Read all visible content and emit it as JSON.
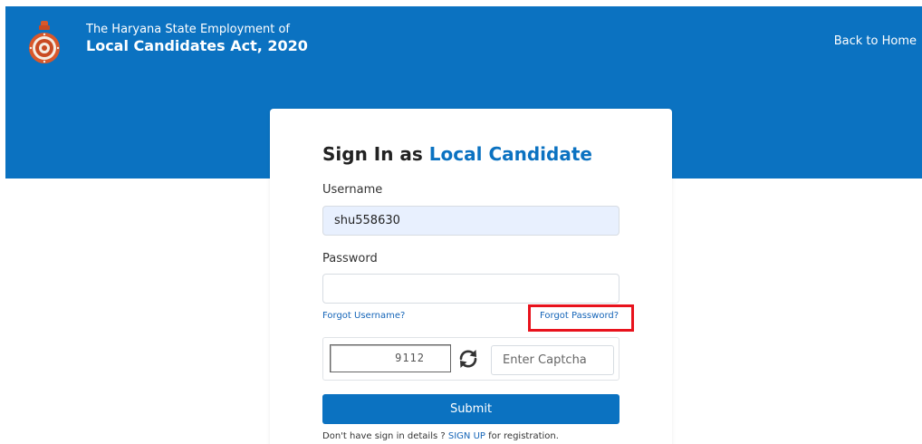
{
  "header": {
    "brand_line1": "The Haryana State Employment of",
    "brand_line2": "Local Candidates Act, 2020",
    "back_home_label": "Back to Home",
    "logo_icon": "haryana-emblem-icon",
    "background_color": "#0b72c1"
  },
  "login": {
    "title_prefix": "Sign In as",
    "title_accent": "Local Candidate",
    "username_label": "Username",
    "username_value": "shu558630",
    "password_label": "Password",
    "password_value": "",
    "forgot_username_label": "Forgot Username?",
    "forgot_password_label": "Forgot Password?",
    "captcha_code": "9112",
    "captcha_refresh_icon": "refresh-icon",
    "captcha_placeholder": "Enter Captcha",
    "submit_label": "Submit",
    "signup_prefix": "Don't have sign in details ? ",
    "signup_link_label": "SIGN UP",
    "signup_suffix": " for registration."
  },
  "colors": {
    "accent": "#0b72c1",
    "link": "#1565b8",
    "highlight": "#e8121c",
    "autofill_bg": "#e8f0fe"
  }
}
